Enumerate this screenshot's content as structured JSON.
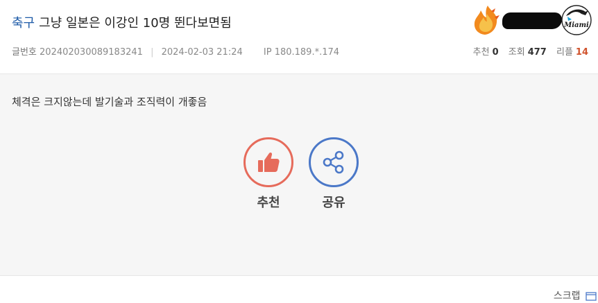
{
  "post": {
    "category": "축구",
    "title": "그냥 일본은 이강인 10명 뛴다보면됨",
    "meta": {
      "number_label": "글번호",
      "number": "20240203008918324​1",
      "datetime": "2024-02-03 21:24",
      "ip": "IP 180.189.*.174"
    },
    "stats": {
      "recommend_label": "추천",
      "recommend_value": "0",
      "views_label": "조회",
      "views_value": "477",
      "reply_label": "리플",
      "reply_value": "14"
    },
    "author": {
      "level_icon": "flame-icon",
      "team_icon": "marlins-logo-icon",
      "team_logo_text": "Miami"
    }
  },
  "content": {
    "text": "체격은 크지않는데 발기술과 조직력이 개좋음"
  },
  "actions": {
    "recommend_label": "추천",
    "share_label": "공유"
  },
  "footer": {
    "scrap_label": "스크랩"
  },
  "colors": {
    "category": "#1e5ba8",
    "recommend": "#e66b5b",
    "share": "#4b78c8",
    "reply_count": "#d0532d",
    "content_bg": "#f6f6f6"
  }
}
